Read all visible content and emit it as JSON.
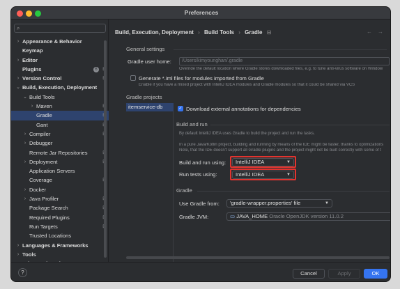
{
  "window": {
    "title": "Preferences"
  },
  "search": {
    "placeholder": ""
  },
  "sidebar": {
    "items": [
      {
        "label": "Appearance & Behavior",
        "level": 0,
        "chevron": "›",
        "bold": true
      },
      {
        "label": "Keymap",
        "level": 0,
        "chevron": "",
        "bold": true
      },
      {
        "label": "Editor",
        "level": 0,
        "chevron": "›",
        "bold": true
      },
      {
        "label": "Plugins",
        "level": 0,
        "chevron": "",
        "bold": true,
        "badge": "6"
      },
      {
        "label": "Version Control",
        "level": 0,
        "chevron": "›",
        "bold": true
      },
      {
        "label": "Build, Execution, Deployment",
        "level": 0,
        "chevron": "⌄",
        "bold": true
      },
      {
        "label": "Build Tools",
        "level": 1,
        "chevron": "⌄"
      },
      {
        "label": "Maven",
        "level": 2,
        "chevron": "›"
      },
      {
        "label": "Gradle",
        "level": 2,
        "chevron": "",
        "selected": true
      },
      {
        "label": "Gant",
        "level": 2,
        "chevron": ""
      },
      {
        "label": "Compiler",
        "level": 1,
        "chevron": "›"
      },
      {
        "label": "Debugger",
        "level": 1,
        "chevron": "›"
      },
      {
        "label": "Remote Jar Repositories",
        "level": 1,
        "chevron": ""
      },
      {
        "label": "Deployment",
        "level": 1,
        "chevron": "›"
      },
      {
        "label": "Application Servers",
        "level": 1,
        "chevron": ""
      },
      {
        "label": "Coverage",
        "level": 1,
        "chevron": ""
      },
      {
        "label": "Docker",
        "level": 1,
        "chevron": "›"
      },
      {
        "label": "Java Profiler",
        "level": 1,
        "chevron": "›"
      },
      {
        "label": "Package Search",
        "level": 1,
        "chevron": ""
      },
      {
        "label": "Required Plugins",
        "level": 1,
        "chevron": ""
      },
      {
        "label": "Run Targets",
        "level": 1,
        "chevron": ""
      },
      {
        "label": "Trusted Locations",
        "level": 1,
        "chevron": ""
      },
      {
        "label": "Languages & Frameworks",
        "level": 0,
        "chevron": "›",
        "bold": true
      },
      {
        "label": "Tools",
        "level": 0,
        "chevron": "›",
        "bold": true
      },
      {
        "label": "Advanced Settings",
        "level": 0,
        "chevron": "",
        "bold": true
      }
    ]
  },
  "breadcrumb": {
    "part1": "Build, Execution, Deployment",
    "sep": "›",
    "part2": "Build Tools",
    "part3": "Gradle"
  },
  "general": {
    "title": "General settings",
    "user_home_label": "Gradle user home:",
    "user_home_value": "/Users/kimyounghan/.gradle",
    "user_home_hint": "Override the default location where Gradle stores downloaded files, e.g. to tune anti-virus software on Window",
    "iml_label": "Generate *.iml files for modules imported from Gradle",
    "iml_hint1": "Enable if you have a mixed project with IntelliJ IDEA modules and Gradle modules so that it could be shared via VCS"
  },
  "projects": {
    "title": "Gradle projects",
    "items": [
      "itemservice-db"
    ],
    "download_label": "Download external annotations for dependencies",
    "build_run_title": "Build and run",
    "build_run_hint": "By default IntelliJ IDEA uses Gradle to build the project and run the tasks.",
    "pure_hint1": "In a pure Java/Kotlin project, building and running by means of the IDE might be faster, thanks to optimizations",
    "pure_hint2": "Note, that the IDE doesn't support all Gradle plugins and the project might not be built correctly with some of t",
    "build_using_label": "Build and run using:",
    "build_using_value": "IntelliJ IDEA",
    "tests_using_label": "Run tests using:",
    "tests_using_value": "IntelliJ IDEA",
    "gradle_title": "Gradle",
    "use_from_label": "Use Gradle from:",
    "use_from_value": "'gradle-wrapper.properties' file",
    "jvm_label": "Gradle JVM:",
    "jvm_value": "JAVA_HOME",
    "jvm_detail": "Oracle OpenJDK version 11.0.2"
  },
  "footer": {
    "help": "?",
    "cancel": "Cancel",
    "apply": "Apply",
    "ok": "OK"
  },
  "colors": {
    "accent": "#3574f0",
    "selection": "#2e436e",
    "highlight": "#e3342f",
    "background": "#2b2d30"
  }
}
